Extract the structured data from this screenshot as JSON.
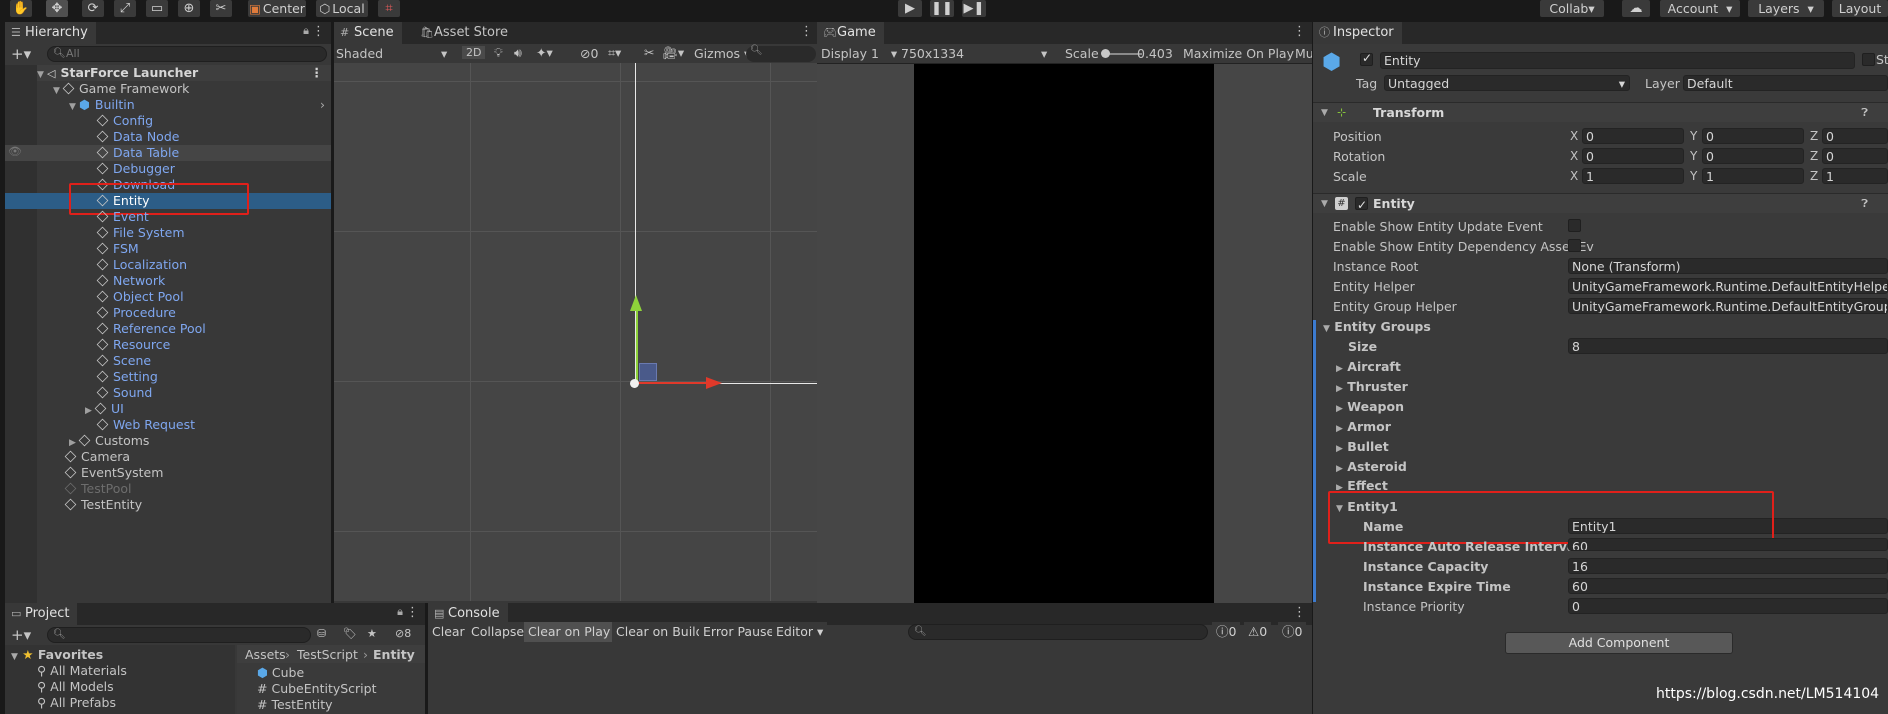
{
  "toolbar": {
    "tools": [
      "hand-icon",
      "move-icon",
      "rotate-icon",
      "scale-icon",
      "rect-icon",
      "transform-icon",
      "custom-tool-icon"
    ],
    "pivot": "Center",
    "space": "Local",
    "collab": "Collab",
    "account": "Account",
    "layers": "Layers",
    "layout": "Layout"
  },
  "hierarchy": {
    "tab": "Hierarchy",
    "search_placeholder": "All",
    "scene": "StarForce Launcher",
    "items": [
      {
        "label": "Game Framework"
      },
      {
        "label": "Builtin"
      },
      {
        "label": "Config"
      },
      {
        "label": "Data Node"
      },
      {
        "label": "Data Table"
      },
      {
        "label": "Debugger"
      },
      {
        "label": "Download"
      },
      {
        "label": "Entity"
      },
      {
        "label": "Event"
      },
      {
        "label": "File System"
      },
      {
        "label": "FSM"
      },
      {
        "label": "Localization"
      },
      {
        "label": "Network"
      },
      {
        "label": "Object Pool"
      },
      {
        "label": "Procedure"
      },
      {
        "label": "Reference Pool"
      },
      {
        "label": "Resource"
      },
      {
        "label": "Scene"
      },
      {
        "label": "Setting"
      },
      {
        "label": "Sound"
      },
      {
        "label": "UI"
      },
      {
        "label": "Web Request"
      },
      {
        "label": "Customs"
      },
      {
        "label": "Camera"
      },
      {
        "label": "EventSystem"
      },
      {
        "label": "TestPool"
      },
      {
        "label": "TestEntity"
      }
    ]
  },
  "scene": {
    "tab": "Scene",
    "tab2": "Asset Store",
    "shading": "Shaded",
    "mode2d": "2D",
    "hidden_count": "0",
    "gizmos": "Gizmos"
  },
  "game": {
    "tab": "Game",
    "display": "Display 1",
    "resolution": "750x1334",
    "scale_label": "Scale",
    "scale_value": "0.403",
    "maximize": "Maximize On Play",
    "mute": "Mu"
  },
  "inspector": {
    "tab": "Inspector",
    "object_name": "Entity",
    "static": "St",
    "tag_label": "Tag",
    "tag_value": "Untagged",
    "layer_label": "Layer",
    "layer_value": "Default",
    "transform": {
      "title": "Transform",
      "rows": [
        {
          "label": "Position",
          "x": "0",
          "y": "0",
          "z": "0"
        },
        {
          "label": "Rotation",
          "x": "0",
          "y": "0",
          "z": "0"
        },
        {
          "label": "Scale",
          "x": "1",
          "y": "1",
          "z": "1"
        }
      ]
    },
    "entity": {
      "title": "Entity",
      "show_update": "Enable Show Entity Update Event",
      "show_dependency": "Enable Show Entity Dependency Asset Ev",
      "instance_root_label": "Instance Root",
      "instance_root_value": "None (Transform)",
      "helper_label": "Entity Helper",
      "helper_value": "UnityGameFramework.Runtime.DefaultEntityHelper",
      "group_helper_label": "Entity Group Helper",
      "group_helper_value": "UnityGameFramework.Runtime.DefaultEntityGroupHelpe",
      "groups_label": "Entity Groups",
      "size_label": "Size",
      "size_value": "8",
      "groups": [
        "Aircraft",
        "Thruster",
        "Weapon",
        "Armor",
        "Bullet",
        "Asteroid",
        "Effect"
      ],
      "entity1": {
        "label": "Entity1",
        "name_label": "Name",
        "name_value": "Entity1",
        "release_label": "Instance Auto Release Interval",
        "release_value": "60",
        "capacity_label": "Instance Capacity",
        "capacity_value": "16",
        "expire_label": "Instance Expire Time",
        "expire_value": "60",
        "priority_label": "Instance Priority",
        "priority_value": "0"
      }
    },
    "add_component": "Add Component"
  },
  "project": {
    "tab": "Project",
    "count": "8",
    "favorites": "Favorites",
    "fav_items": [
      "All Materials",
      "All Models",
      "All Prefabs"
    ],
    "breadcrumb": [
      "Assets",
      "TestScript",
      "Entity"
    ],
    "files": [
      {
        "name": "Cube",
        "icon": "prefab-icon"
      },
      {
        "name": "CubeEntityScript",
        "icon": "script-icon"
      },
      {
        "name": "TestEntity",
        "icon": "script-icon"
      }
    ]
  },
  "console": {
    "tab": "Console",
    "buttons": [
      "Clear",
      "Collapse",
      "Clear on Play",
      "Clear on Build",
      "Error Pause",
      "Editor"
    ],
    "counts": [
      "0",
      "0",
      "0"
    ]
  },
  "watermark": "https://blog.csdn.net/LM514104"
}
